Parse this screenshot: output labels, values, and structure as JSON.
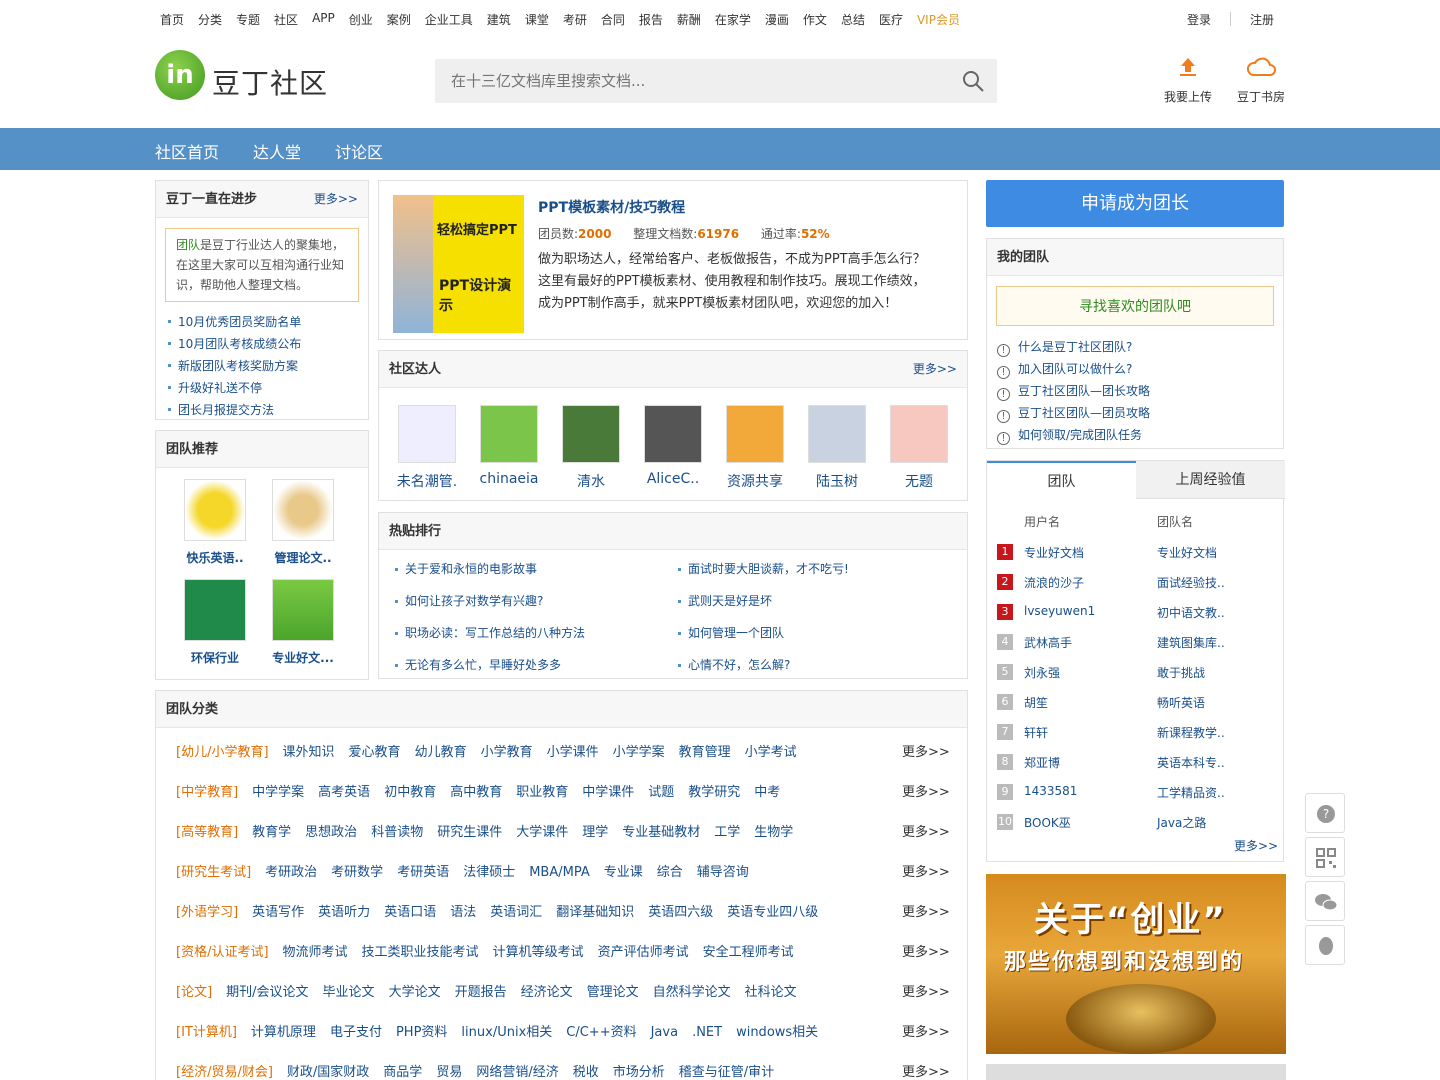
{
  "topnav": {
    "items": [
      "首页",
      "分类",
      "专题",
      "社区",
      "APP",
      "创业",
      "案例",
      "企业工具",
      "建筑",
      "课堂",
      "考研",
      "合同",
      "报告",
      "薪酬",
      "在家学",
      "漫画",
      "作文",
      "总结",
      "医疗"
    ],
    "vip": "VIP会员",
    "login": "登录",
    "register": "注册"
  },
  "header": {
    "logo_mark": "in",
    "logo_text": "豆丁社区",
    "search_placeholder": "在十三亿文档库里搜索文档...",
    "upload_label": "我要上传",
    "shelf_label": "豆丁书房"
  },
  "bluenav": [
    "社区首页",
    "达人堂",
    "讨论区"
  ],
  "progress": {
    "title": "豆丁一直在进步",
    "more": "更多>>",
    "notice_highlight": "团队",
    "notice_text": "是豆丁行业达人的聚集地，在这里大家可以互相沟通行业知识，帮助他人整理文档。",
    "items": [
      "10月优秀团员奖励名单",
      "10月团队考核成绩公布",
      "新版团队考核奖励方案",
      "升级好礼送不停",
      "团长月报提交方法"
    ]
  },
  "recommend": {
    "title": "团队推荐",
    "teams": [
      "快乐英语..",
      "管理论文..",
      "环保行业",
      "专业好文..."
    ]
  },
  "featured": {
    "image_text_1": "轻松搞定PPT",
    "image_text_2": "PPT设计演示",
    "title": "PPT模板素材/技巧教程",
    "members_label": "团员数:",
    "members": "2000",
    "docs_label": "整理文档数:",
    "docs": "61976",
    "rate_label": "通过率:",
    "rate": "52%",
    "desc": "做为职场达人，经常给客户、老板做报告，不成为PPT高手怎么行？这里有最好的PPT模板素材、使用教程和制作技巧。展现工作绩效，成为PPT制作高手，就来PPT模板素材团队吧，欢迎您的加入！"
  },
  "experts": {
    "title": "社区达人",
    "more": "更多>>",
    "users": [
      "未名潮管.",
      "chinaeia",
      "清水",
      "AliceC..",
      "资源共享",
      "陆玉树",
      "无题"
    ]
  },
  "hot": {
    "title": "热贴排行",
    "left": [
      "关于爱和永恒的电影故事",
      "如何让孩子对数学有兴趣?",
      "职场必读：写工作总结的八种方法",
      "无论有多么忙，早睡好处多多"
    ],
    "right": [
      "面试时要大胆谈薪，才不吃亏!",
      "武则天是好是坏",
      "如何管理一个团队",
      "心情不好，怎么解?"
    ]
  },
  "categories": {
    "title": "团队分类",
    "more": "更多>>",
    "rows": [
      {
        "cat": "[幼儿/小学教育]",
        "subs": [
          "课外知识",
          "爱心教育",
          "幼儿教育",
          "小学教育",
          "小学课件",
          "小学学案",
          "教育管理",
          "小学考试"
        ]
      },
      {
        "cat": "[中学教育]",
        "subs": [
          "中学学案",
          "高考英语",
          "初中教育",
          "高中教育",
          "职业教育",
          "中学课件",
          "试题",
          "教学研究",
          "中考"
        ]
      },
      {
        "cat": "[高等教育]",
        "subs": [
          "教育学",
          "思想政治",
          "科普读物",
          "研究生课件",
          "大学课件",
          "理学",
          "专业基础教材",
          "工学",
          "生物学"
        ]
      },
      {
        "cat": "[研究生考试]",
        "subs": [
          "考研政治",
          "考研数学",
          "考研英语",
          "法律硕士",
          "MBA/MPA",
          "专业课",
          "综合",
          "辅导咨询"
        ]
      },
      {
        "cat": "[外语学习]",
        "subs": [
          "英语写作",
          "英语听力",
          "英语口语",
          "语法",
          "英语词汇",
          "翻译基础知识",
          "英语四六级",
          "英语专业四八级"
        ]
      },
      {
        "cat": "[资格/认证考试]",
        "subs": [
          "物流师考试",
          "技工类职业技能考试",
          "计算机等级考试",
          "资产评估师考试",
          "安全工程师考试"
        ]
      },
      {
        "cat": "[论文]",
        "subs": [
          "期刊/会议论文",
          "毕业论文",
          "大学论文",
          "开题报告",
          "经济论文",
          "管理论文",
          "自然科学论文",
          "社科论文"
        ]
      },
      {
        "cat": "[IT计算机]",
        "subs": [
          "计算机原理",
          "电子支付",
          "PHP资料",
          "linux/Unix相关",
          "C/C++资料",
          "Java",
          ".NET",
          "windows相关"
        ]
      },
      {
        "cat": "[经济/贸易/财会]",
        "subs": [
          "财政/国家财政",
          "商品学",
          "贸易",
          "网络营销/经济",
          "税收",
          "市场分析",
          "稽查与征管/审计"
        ]
      }
    ]
  },
  "right": {
    "apply": "申请成为团长",
    "myteam_title": "我的团队",
    "find_team": "寻找喜欢的团队吧",
    "faq": [
      "什么是豆丁社区团队?",
      "加入团队可以做什么?",
      "豆丁社区团队—团长攻略",
      "豆丁社区团队—团员攻略",
      "如何领取/完成团队任务"
    ],
    "tabs": [
      "团队",
      "上周经验值"
    ],
    "rank_head_user": "用户名",
    "rank_head_team": "团队名",
    "ranks": [
      {
        "n": "1",
        "user": "专业好文档",
        "team": "专业好文档"
      },
      {
        "n": "2",
        "user": "流浪的沙子",
        "team": "面试经验技.."
      },
      {
        "n": "3",
        "user": "lvseyuwen1",
        "team": "初中语文教.."
      },
      {
        "n": "4",
        "user": "武林高手",
        "team": "建筑图集库.."
      },
      {
        "n": "5",
        "user": "刘永强",
        "team": "敢于挑战"
      },
      {
        "n": "6",
        "user": "胡笙",
        "team": "畅听英语"
      },
      {
        "n": "7",
        "user": "轩轩",
        "team": "新课程教学.."
      },
      {
        "n": "8",
        "user": "郑亚博",
        "team": "英语本科专.."
      },
      {
        "n": "9",
        "user": "1433581",
        "team": "工学精品资.."
      },
      {
        "n": "10",
        "user": "BOOK巫",
        "team": "Java之路"
      }
    ],
    "rank_more": "更多>>",
    "ad_line1": "关于“创业”",
    "ad_line2": "那些你想到和没想到的"
  },
  "colors": {
    "nav_blue": "#5590c7",
    "btn_blue": "#3d8be2",
    "orange": "#e06e00",
    "link": "#1a4f8a",
    "rank_hot": "#c8161d"
  }
}
